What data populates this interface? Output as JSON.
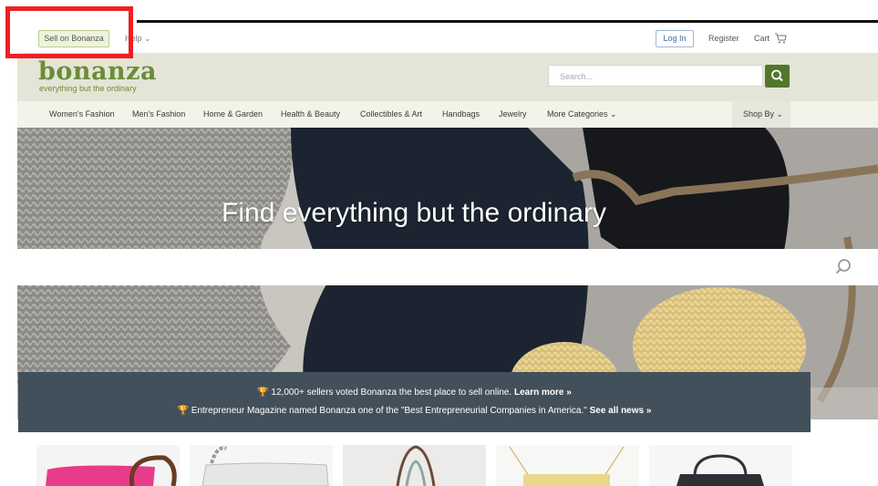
{
  "topbar": {
    "sell_label": "Sell on Bonanza",
    "help_label": "Help ⌄",
    "login_label": "Log In",
    "register_label": "Register",
    "cart_label": "Cart"
  },
  "header": {
    "logo": "bonanza",
    "tagline": "everything but the ordinary",
    "search_placeholder": "Search..."
  },
  "nav": {
    "items": [
      "Women's Fashion",
      "Men's Fashion",
      "Home & Garden",
      "Health & Beauty",
      "Collectibles & Art",
      "Handbags",
      "Jewelry",
      "More Categories ⌄"
    ],
    "shop_by": "Shop By ⌄"
  },
  "hero": {
    "title": "Find everything but the ordinary"
  },
  "news": {
    "line1_text": "12,000+ sellers voted Bonanza the best place to sell online.",
    "line1_link": "Learn more »",
    "line2_text": "Entrepreneur Magazine named Bonanza one of the \"Best Entrepreneurial Companies in America.\"",
    "line2_link": "See all news »"
  },
  "colors": {
    "brand_green": "#6d8c3a",
    "search_button": "#52762a",
    "banner": "#42505b",
    "highlight": "#ee1f23"
  },
  "icons": [
    "cart-icon",
    "search-icon",
    "trophy-icon"
  ]
}
